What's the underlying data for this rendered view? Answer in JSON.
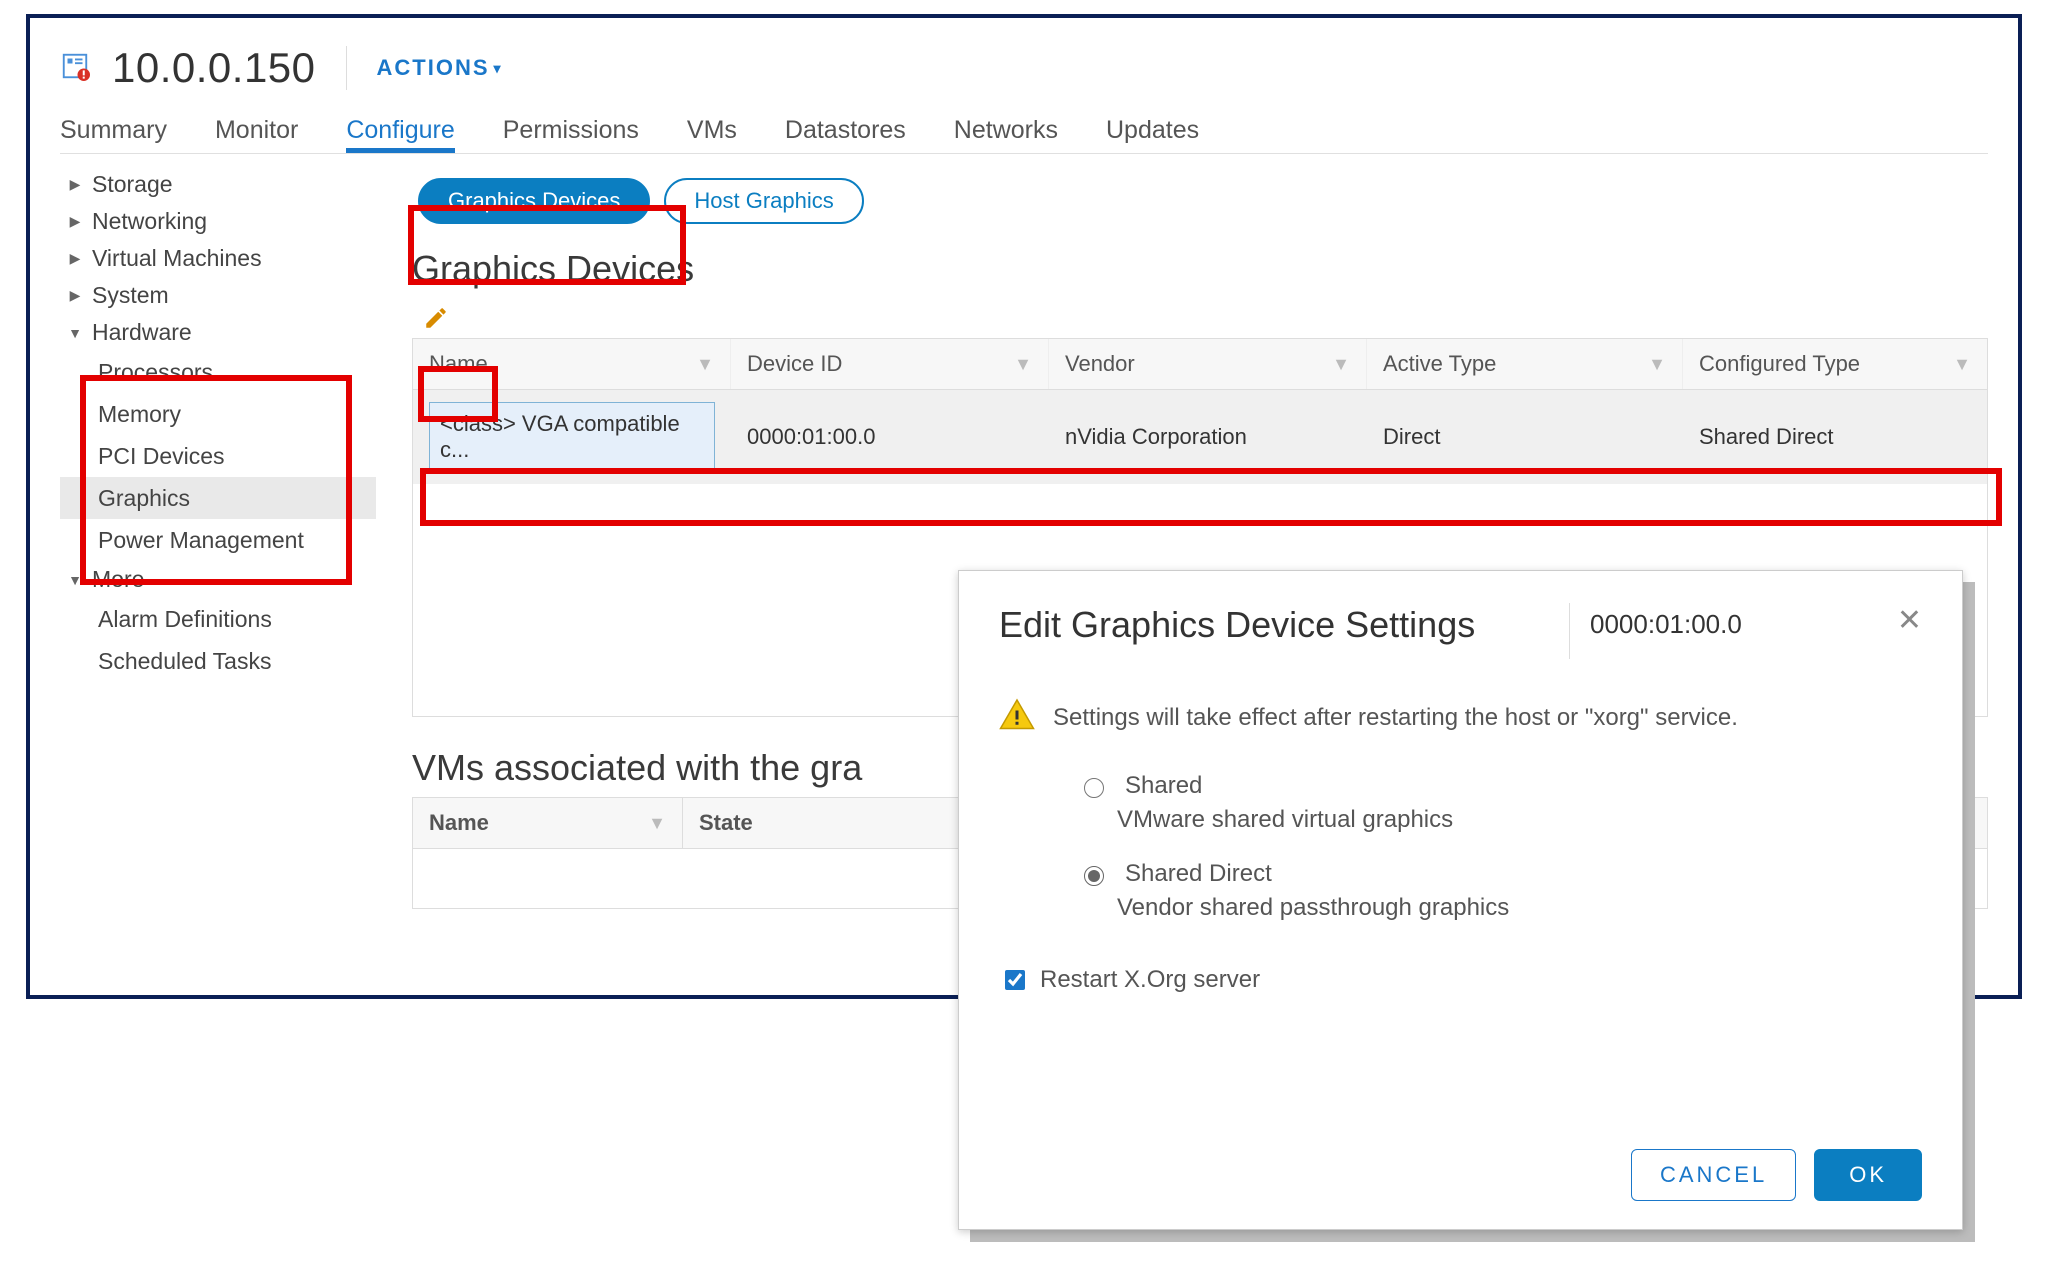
{
  "header": {
    "host": "10.0.0.150",
    "actions": "ACTIONS"
  },
  "tabs": [
    "Summary",
    "Monitor",
    "Configure",
    "Permissions",
    "VMs",
    "Datastores",
    "Networks",
    "Updates"
  ],
  "active_tab": "Configure",
  "sidebar": {
    "storage": "Storage",
    "networking": "Networking",
    "vms": "Virtual Machines",
    "system": "System",
    "hardware": "Hardware",
    "hardware_children": [
      "Processors",
      "Memory",
      "PCI Devices",
      "Graphics",
      "Power Management"
    ],
    "hardware_selected": "Graphics",
    "more": "More",
    "more_children": [
      "Alarm Definitions",
      "Scheduled Tasks"
    ]
  },
  "pills": {
    "graphics_devices": "Graphics Devices",
    "host_graphics": "Host Graphics"
  },
  "section": {
    "title": "Graphics Devices"
  },
  "grid": {
    "headers": [
      "Name",
      "Device ID",
      "Vendor",
      "Active Type",
      "Configured Type"
    ],
    "row": {
      "name": "<class> VGA compatible c...",
      "device_id": "0000:01:00.0",
      "vendor": "nVidia Corporation",
      "active_type": "Direct",
      "configured_type": "Shared Direct"
    }
  },
  "section2": {
    "title": "VMs associated with the gra"
  },
  "grid2": {
    "headers": [
      "Name",
      "State"
    ]
  },
  "dialog": {
    "title": "Edit Graphics Device Settings",
    "device": "0000:01:00.0",
    "warning": "Settings will take effect after restarting the host or \"xorg\" service.",
    "opt_shared": {
      "title": "Shared",
      "desc": "VMware shared virtual graphics"
    },
    "opt_shared_direct": {
      "title": "Shared Direct",
      "desc": "Vendor shared passthrough graphics"
    },
    "restart": "Restart X.Org server",
    "cancel": "CANCEL",
    "ok": "OK"
  }
}
